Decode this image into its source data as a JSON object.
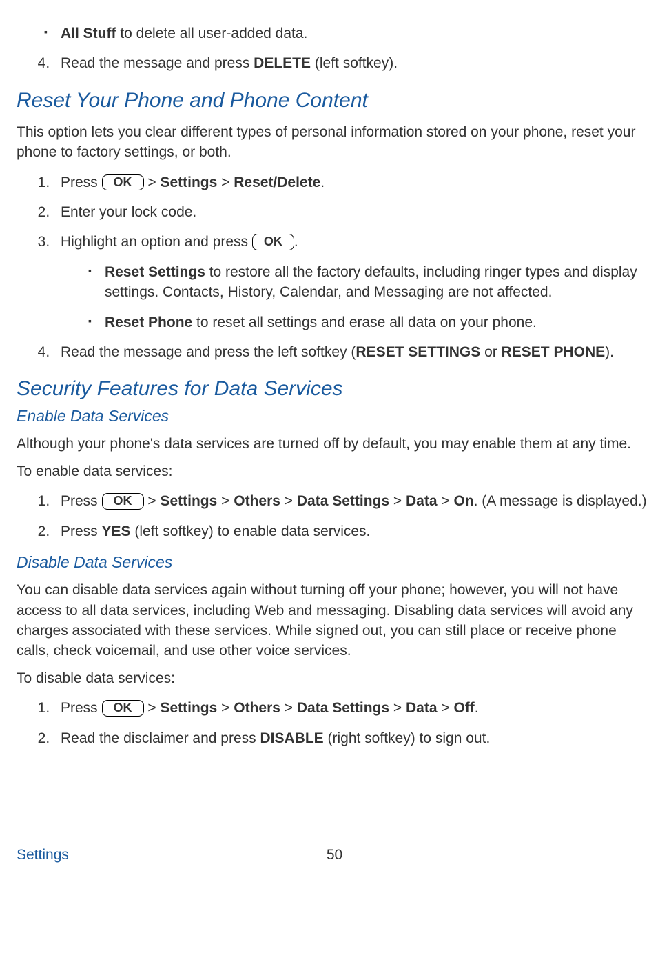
{
  "ok_label": "OK",
  "top": {
    "allstuff_bold": "All Stuff",
    "allstuff_rest": " to delete all user-added data.",
    "step4_a": "Read the message and press ",
    "step4_bold": "DELETE",
    "step4_b": " (left softkey)."
  },
  "reset": {
    "heading": "Reset Your Phone and Phone Content",
    "intro": "This option lets you clear different types of personal information stored on your phone, reset your phone to factory settings, or both.",
    "s1_a": "Press ",
    "s1_b": " > ",
    "s1_bold1": "Settings",
    "s1_c": " > ",
    "s1_bold2": "Reset/Delete",
    "s1_d": ".",
    "s2": "Enter your lock code.",
    "s3_a": "Highlight an option and press ",
    "s3_b": ".",
    "b1_bold": "Reset Settings",
    "b1_rest": " to restore all the factory defaults, including ringer types and display settings. Contacts, History, Calendar, and Messaging are not affected.",
    "b2_bold": "Reset Phone",
    "b2_rest": " to reset all settings and erase all data on your phone.",
    "s4_a": "Read the message and press the left softkey (",
    "s4_bold1": "RESET SETTINGS",
    "s4_mid": " or ",
    "s4_bold2": "RESET PHONE",
    "s4_b": ")."
  },
  "security": {
    "heading": "Security Features for Data Services",
    "enable_h": "Enable Data Services",
    "enable_intro": "Although your phone's data services are turned off by default, you may enable them at any time.",
    "enable_lead": "To enable data services:",
    "e1_a": "Press ",
    "e1_b": " > ",
    "e1_bold1": "Settings",
    "e1_c": " > ",
    "e1_bold2": "Others",
    "e1_d": " > ",
    "e1_bold3": "Data Settings",
    "e1_e": " > ",
    "e1_bold4": "Data",
    "e1_f": " > ",
    "e1_bold5": "On",
    "e1_g": ". (A message is displayed.)",
    "e2_a": "Press ",
    "e2_bold": "YES",
    "e2_b": " (left softkey) to enable data services.",
    "disable_h": "Disable Data Services",
    "disable_intro": "You can disable data services again without turning off your phone; however, you will not have access to all data services, including Web and messaging. Disabling data services will avoid any charges associated with these services. While signed out, you can still place or receive phone calls, check voicemail, and use other voice services.",
    "disable_lead": "To disable data services:",
    "d1_a": "Press ",
    "d1_b": " > ",
    "d1_bold1": "Settings",
    "d1_c": " > ",
    "d1_bold2": "Others",
    "d1_d": " > ",
    "d1_bold3": "Data Settings",
    "d1_e": " > ",
    "d1_bold4": "Data",
    "d1_f": " > ",
    "d1_bold5": "Off",
    "d1_g": ".",
    "d2_a": "Read the disclaimer and press ",
    "d2_bold": "DISABLE",
    "d2_b": " (right softkey) to sign out."
  },
  "footer": {
    "section": "Settings",
    "page": "50"
  }
}
